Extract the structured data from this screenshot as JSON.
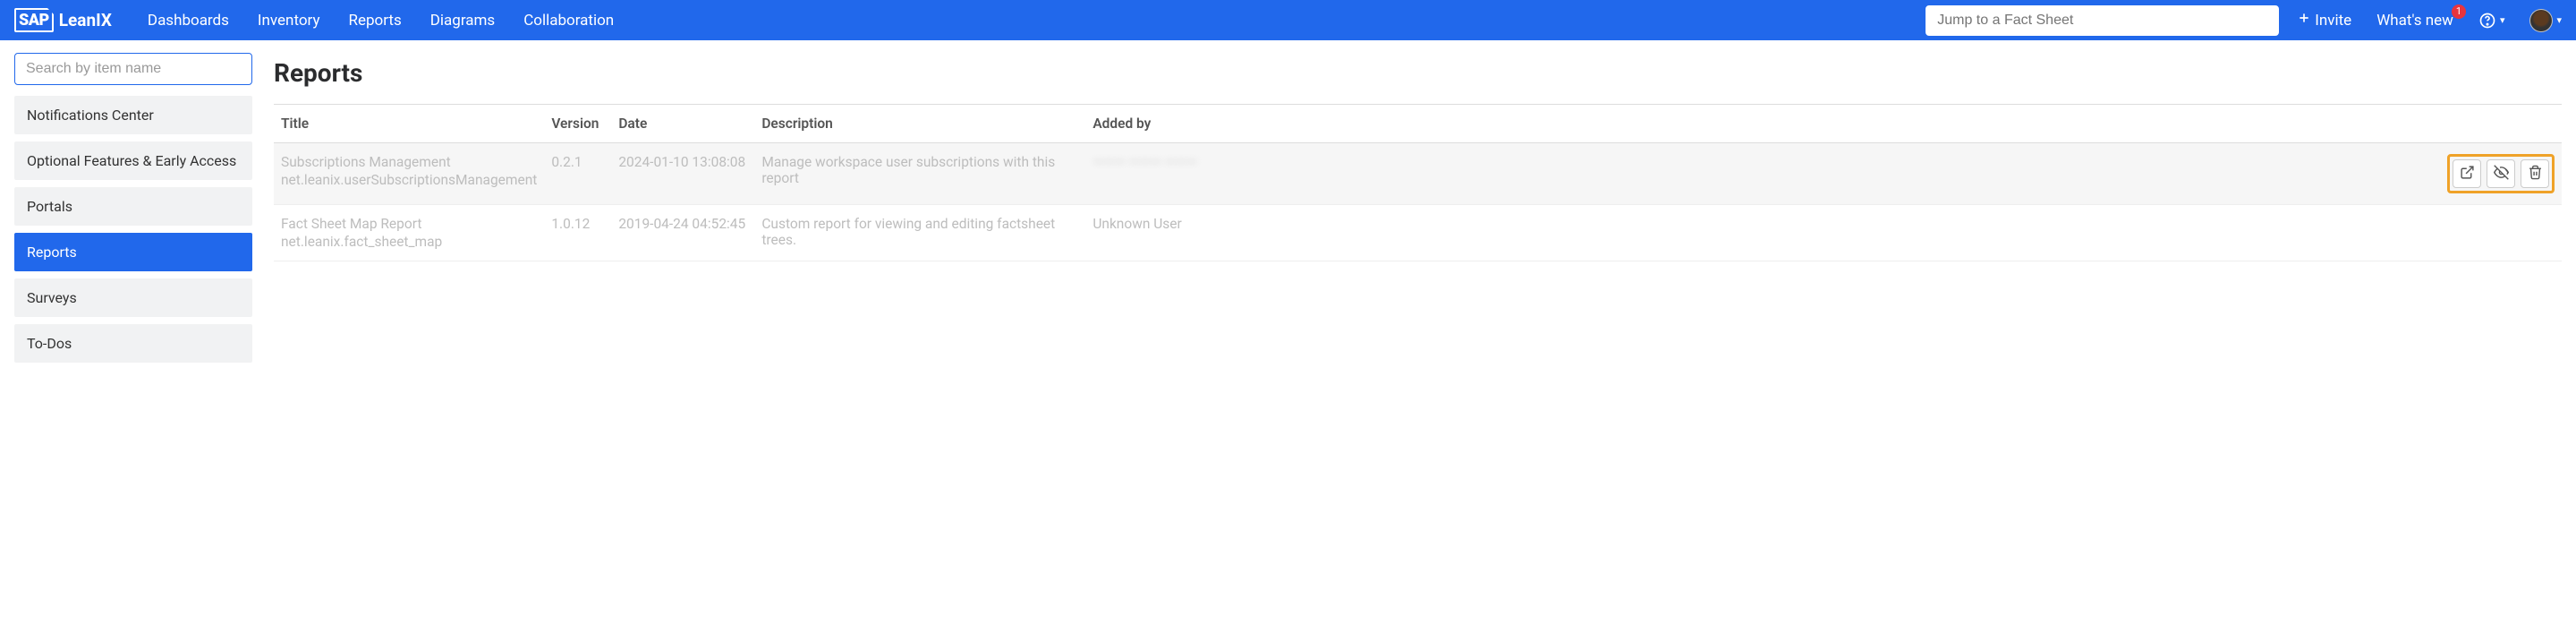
{
  "brand": {
    "sap": "SAP",
    "app": "LeanIX"
  },
  "nav": {
    "items": [
      "Dashboards",
      "Inventory",
      "Reports",
      "Diagrams",
      "Collaboration"
    ],
    "jump_placeholder": "Jump to a Fact Sheet",
    "invite": "Invite",
    "whatsnew": "What's new",
    "badge": "1"
  },
  "sidebar": {
    "search_placeholder": "Search by item name",
    "items": [
      {
        "label": "Notifications Center",
        "active": false
      },
      {
        "label": "Optional Features & Early Access",
        "active": false
      },
      {
        "label": "Portals",
        "active": false
      },
      {
        "label": "Reports",
        "active": true
      },
      {
        "label": "Surveys",
        "active": false
      },
      {
        "label": "To-Dos",
        "active": false
      }
    ]
  },
  "page": {
    "title": "Reports"
  },
  "table": {
    "headers": {
      "title": "Title",
      "version": "Version",
      "date": "Date",
      "description": "Description",
      "added_by": "Added by"
    },
    "rows": [
      {
        "title": "Subscriptions Management",
        "sub": "net.leanix.userSubscriptionsManagement",
        "version": "0.2.1",
        "date": "2024-01-10 13:08:08",
        "description": "Manage workspace user subscriptions with this report",
        "added_by": "——— ——— ———",
        "added_by_blurred": true,
        "hovered": true,
        "actions": true
      },
      {
        "title": "Fact Sheet Map Report",
        "sub": "net.leanix.fact_sheet_map",
        "version": "1.0.12",
        "date": "2019-04-24 04:52:45",
        "description": "Custom report for viewing and editing factsheet trees.",
        "added_by": "Unknown User",
        "added_by_blurred": false,
        "hovered": false,
        "actions": false
      }
    ]
  }
}
